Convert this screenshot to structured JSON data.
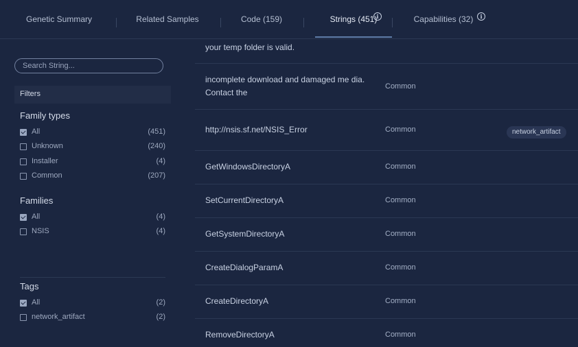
{
  "tabs": [
    {
      "label": "Genetic Summary"
    },
    {
      "label": "Related Samples"
    },
    {
      "label": "Code (159)"
    },
    {
      "label": "Strings (451)"
    },
    {
      "label": "Capabilities (32)"
    }
  ],
  "search": {
    "placeholder": "Search String..."
  },
  "filters": {
    "title": "Filters",
    "family_types": {
      "title": "Family types",
      "items": [
        {
          "label": "All",
          "count": "(451)",
          "checked": true
        },
        {
          "label": "Unknown",
          "count": "(240)",
          "checked": false
        },
        {
          "label": "Installer",
          "count": "(4)",
          "checked": false
        },
        {
          "label": "Common",
          "count": "(207)",
          "checked": false
        }
      ]
    },
    "families": {
      "title": "Families",
      "items": [
        {
          "label": "All",
          "count": "(4)",
          "checked": true
        },
        {
          "label": "NSIS",
          "count": "(4)",
          "checked": false
        }
      ]
    },
    "tags": {
      "title": "Tags",
      "items": [
        {
          "label": "All",
          "count": "(2)",
          "checked": true
        },
        {
          "label": "network_artifact",
          "count": "(2)",
          "checked": false
        }
      ]
    }
  },
  "strings": [
    {
      "text": "your temp folder is valid.",
      "family": ""
    },
    {
      "text": "incomplete download and damaged me dia. Contact the",
      "family": "Common"
    },
    {
      "text": "http://nsis.sf.net/NSIS_Error",
      "family": "Common",
      "tag": "network_artifact"
    },
    {
      "text": "GetWindowsDirectoryA",
      "family": "Common"
    },
    {
      "text": "SetCurrentDirectoryA",
      "family": "Common"
    },
    {
      "text": "GetSystemDirectoryA",
      "family": "Common"
    },
    {
      "text": "CreateDialogParamA",
      "family": "Common"
    },
    {
      "text": "CreateDirectoryA",
      "family": "Common"
    },
    {
      "text": "RemoveDirectoryA",
      "family": "Common"
    }
  ]
}
